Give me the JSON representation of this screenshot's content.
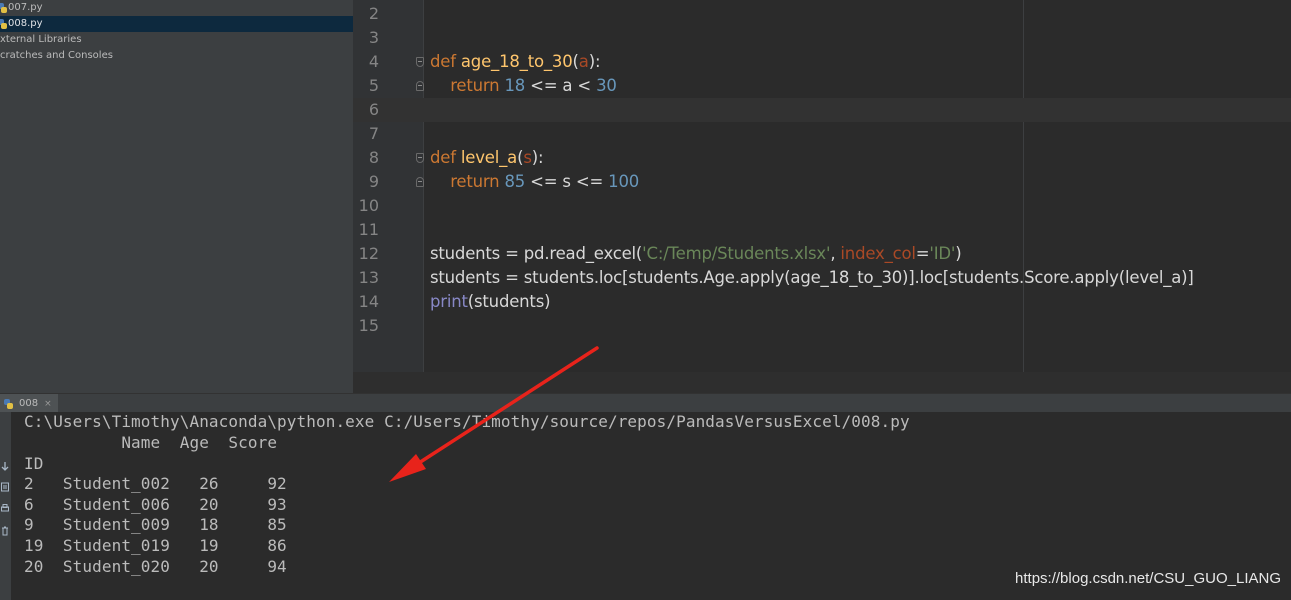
{
  "sidebar": {
    "items": [
      {
        "label": "007.py",
        "icon": "python-file-icon",
        "selected": false
      },
      {
        "label": "008.py",
        "icon": "python-file-icon",
        "selected": true
      },
      {
        "label": "xternal Libraries",
        "icon": "",
        "selected": false
      },
      {
        "label": "cratches and Consoles",
        "icon": "",
        "selected": false
      }
    ]
  },
  "editor": {
    "line_numbers": [
      "2",
      "3",
      "4",
      "5",
      "6",
      "7",
      "8",
      "9",
      "10",
      "11",
      "12",
      "13",
      "14",
      "15"
    ]
  },
  "run_panel": {
    "tab_label": "008",
    "tab_close": "×",
    "console_lines": [
      "C:\\Users\\Timothy\\Anaconda\\python.exe C:/Users/Timothy/source/repos/PandasVersusExcel/008.py",
      "          Name  Age  Score",
      "ID",
      "2   Student_002   26     92",
      "6   Student_006   20     93",
      "9   Student_009   18     85",
      "19  Student_019   19     86",
      "20  Student_020   20     94"
    ]
  },
  "watermark": "https://blog.csdn.net/CSU_GUO_LIANG",
  "colors": {
    "arrow": "#e8231b",
    "keyword": "#cc7832",
    "function": "#ffc66d",
    "number": "#6897bb",
    "string": "#6a8759"
  }
}
